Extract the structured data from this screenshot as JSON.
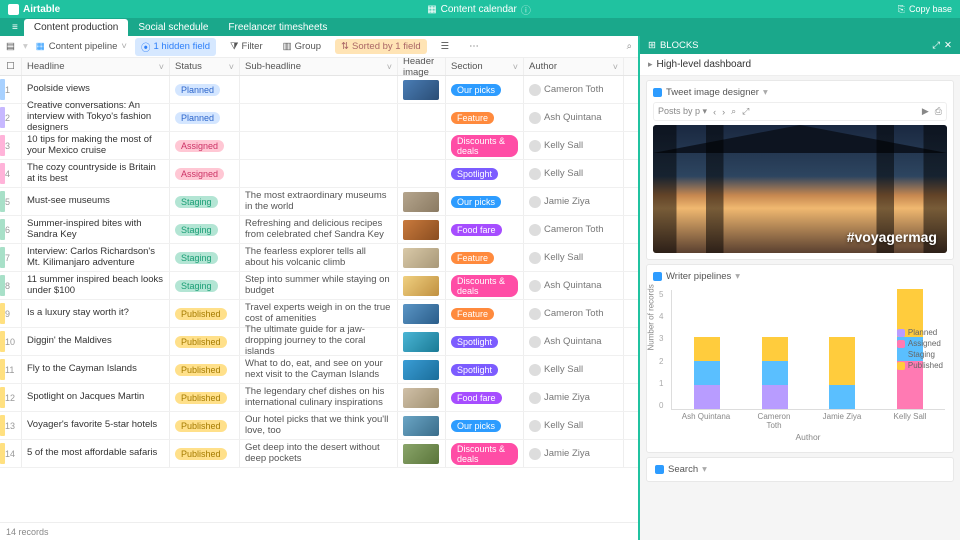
{
  "app": {
    "brand": "Airtable",
    "title": "Content calendar",
    "copy_base": "Copy base"
  },
  "tabs": [
    {
      "label": "Content production",
      "active": true
    },
    {
      "label": "Social schedule",
      "active": false
    },
    {
      "label": "Freelancer timesheets",
      "active": false
    }
  ],
  "view": {
    "name": "Content pipeline",
    "hidden_fields": "1 hidden field",
    "filter": "Filter",
    "group": "Group",
    "sorted": "Sorted by 1 field"
  },
  "columns": {
    "headline": "Headline",
    "status": "Status",
    "sub": "Sub-headline",
    "image": "Header image",
    "section": "Section",
    "author": "Author"
  },
  "statuses": {
    "planned": "Planned",
    "assigned": "Assigned",
    "staging": "Staging",
    "published": "Published"
  },
  "sections": {
    "ourpicks": "Our picks",
    "feature": "Feature",
    "deals": "Discounts & deals",
    "spotlight": "Spotlight",
    "food": "Food fare"
  },
  "rows": [
    {
      "n": 1,
      "bar": "blue",
      "headline": "Poolside views",
      "status": "planned",
      "sub": "",
      "img": "#4a7db5,#2a4d75",
      "section": "ourpicks",
      "author": "Cameron Toth"
    },
    {
      "n": 2,
      "bar": "purple",
      "headline": "Creative conversations: An interview with Tokyo's fashion designers",
      "status": "planned",
      "sub": "",
      "img": "",
      "section": "feature",
      "author": "Ash Quintana"
    },
    {
      "n": 3,
      "bar": "pink",
      "headline": "10 tips for making the most of your Mexico cruise",
      "status": "assigned",
      "sub": "",
      "img": "",
      "section": "deals",
      "author": "Kelly Sall"
    },
    {
      "n": 4,
      "bar": "pink",
      "headline": "The cozy countryside is Britain at its best",
      "status": "assigned",
      "sub": "",
      "img": "",
      "section": "spotlight",
      "author": "Kelly Sall"
    },
    {
      "n": 5,
      "bar": "green",
      "headline": "Must-see museums",
      "status": "staging",
      "sub": "The most extraordinary museums in the world",
      "img": "#b5a58d,#8a7a62",
      "section": "ourpicks",
      "author": "Jamie Ziya"
    },
    {
      "n": 6,
      "bar": "green",
      "headline": "Summer-inspired bites with Sandra Key",
      "status": "staging",
      "sub": "Refreshing and delicious recipes from celebrated chef Sandra Key",
      "img": "#c97a3d,#8a4d20",
      "section": "food",
      "author": "Cameron Toth"
    },
    {
      "n": 7,
      "bar": "green",
      "headline": "Interview: Carlos Richardson's Mt. Kilimanjaro adventure",
      "status": "staging",
      "sub": "The fearless explorer tells all about his volcanic climb",
      "img": "#d9c9a8,#a89878",
      "section": "feature",
      "author": "Kelly Sall"
    },
    {
      "n": 8,
      "bar": "green",
      "headline": "11 summer inspired beach looks under $100",
      "status": "staging",
      "sub": "Step into summer while staying on budget",
      "img": "#f0d080,#c09040",
      "section": "deals",
      "author": "Ash Quintana"
    },
    {
      "n": 9,
      "bar": "yellow",
      "headline": "Is a luxury stay worth it?",
      "status": "published",
      "sub": "Travel experts weigh in on the true cost of amenities",
      "img": "#5a95c5,#2a5d8a",
      "section": "feature",
      "author": "Cameron Toth"
    },
    {
      "n": 10,
      "bar": "yellow",
      "headline": "Diggin' the Maldives",
      "status": "published",
      "sub": "The ultimate guide for a jaw-dropping journey to the coral islands",
      "img": "#4ab5d5,#1a7a95",
      "section": "spotlight",
      "author": "Ash Quintana"
    },
    {
      "n": 11,
      "bar": "yellow",
      "headline": "Fly to the Cayman Islands",
      "status": "published",
      "sub": "What to do, eat, and see on your next visit to the Cayman Islands",
      "img": "#3a9dd5,#1a6d9a",
      "section": "spotlight",
      "author": "Kelly Sall"
    },
    {
      "n": 12,
      "bar": "yellow",
      "headline": "Spotlight on Jacques Martin",
      "status": "published",
      "sub": "The legendary chef dishes on his international culinary inspirations",
      "img": "#d0c0a8,#a09070",
      "section": "food",
      "author": "Jamie Ziya"
    },
    {
      "n": 13,
      "bar": "yellow",
      "headline": "Voyager's favorite 5-star hotels",
      "status": "published",
      "sub": "Our hotel picks that we think you'll love, too",
      "img": "#6aa5c5,#3a6d8a",
      "section": "ourpicks",
      "author": "Kelly Sall"
    },
    {
      "n": 14,
      "bar": "yellow",
      "headline": "5 of the most affordable safaris",
      "status": "published",
      "sub": "Get deep into the desert without deep pockets",
      "img": "#8aa56a,#5a753a",
      "section": "deals",
      "author": "Jamie Ziya"
    }
  ],
  "footer": {
    "count": "14 records"
  },
  "blocks": {
    "header": "BLOCKS",
    "dashboard": "High-level dashboard",
    "tweet": {
      "title": "Tweet image designer",
      "control": "Posts by p",
      "hashtag": "#voyagermag"
    },
    "pipelines": {
      "title": "Writer pipelines"
    },
    "search": {
      "title": "Search"
    }
  },
  "chart_data": {
    "type": "bar",
    "stacked": true,
    "categories": [
      "Ash Quintana",
      "Cameron Toth",
      "Jamie Ziya",
      "Kelly Sall"
    ],
    "series": [
      {
        "name": "Planned",
        "color": "#b89cff",
        "values": [
          1,
          1,
          0,
          0
        ]
      },
      {
        "name": "Assigned",
        "color": "#ff7ab3",
        "values": [
          0,
          0,
          0,
          2
        ]
      },
      {
        "name": "Staging",
        "color": "#5abfff",
        "values": [
          1,
          1,
          1,
          1
        ]
      },
      {
        "name": "Published",
        "color": "#ffcc3d",
        "values": [
          1,
          1,
          2,
          2
        ]
      }
    ],
    "xlabel": "Author",
    "ylabel": "Number of records",
    "ylim": [
      0,
      5
    ],
    "yticks": [
      0,
      1,
      2,
      3,
      4,
      5
    ]
  }
}
